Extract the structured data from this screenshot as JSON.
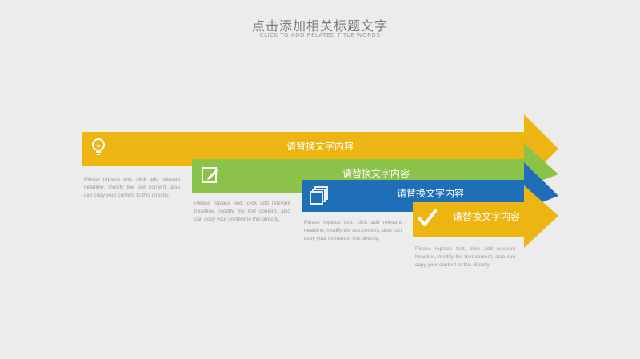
{
  "title": "点击添加相关标题文字",
  "subtitle": "CLICK TO ADD RELATED TITLE WORDS",
  "steps": [
    {
      "label": "请替换文字内容",
      "color": "#edb512",
      "icon": "lightbulb-icon",
      "desc": "Please replace text, click add relevant headline, modify the text content, also can copy your content to this directly."
    },
    {
      "label": "请替换文字内容",
      "color": "#8bc34a",
      "icon": "edit-icon",
      "desc": "Please replace text, click add relevant headline, modify the text content, also can copy your content to this directly."
    },
    {
      "label": "请替换文字内容",
      "color": "#1e6fb8",
      "icon": "documents-icon",
      "desc": "Please replace text, click add relevant headline, modify the text content, also can copy your content to this directly."
    },
    {
      "label": "请替换文字内容",
      "color": "#edb512",
      "icon": "checkmark-icon",
      "desc": "Please replace text, click add relevant headline, modify the text content, also can copy your content to this directly."
    }
  ]
}
